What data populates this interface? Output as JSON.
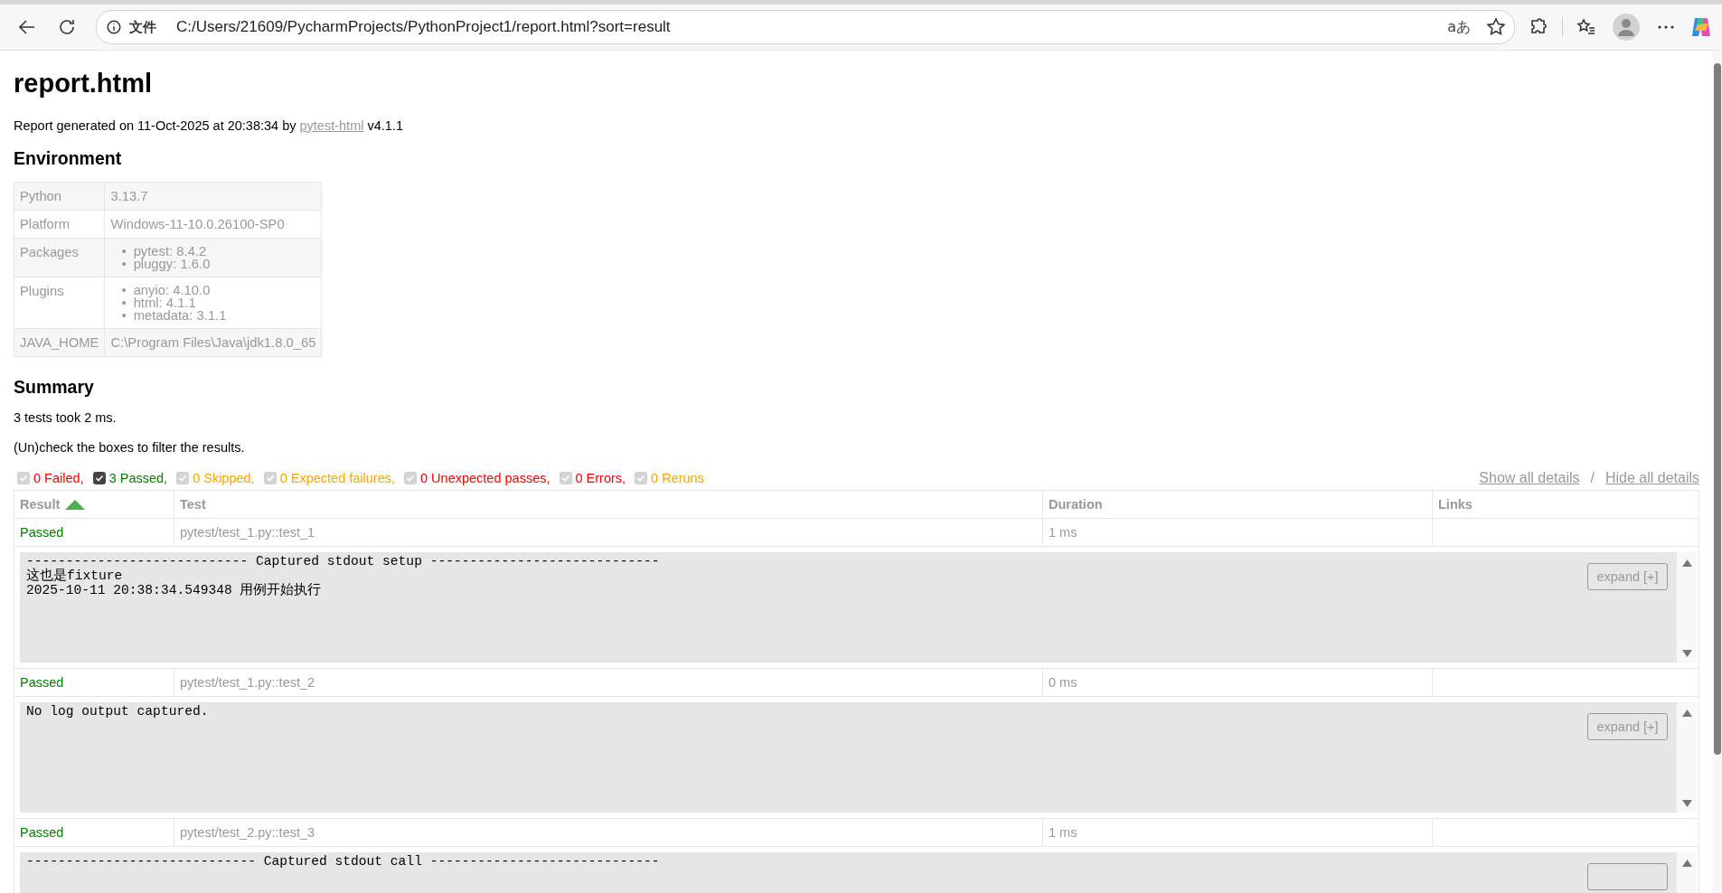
{
  "browser": {
    "site_label": "文件",
    "url": "C:/Users/21609/PycharmProjects/PythonProject1/report.html?sort=result",
    "translate_glyph": "aあ"
  },
  "report": {
    "title": "report.html",
    "generated": {
      "before": "Report generated on 11-Oct-2025 at 20:38:34 by ",
      "link": "pytest-html",
      "after": " v4.1.1"
    },
    "environment": {
      "heading": "Environment",
      "bullet": "•",
      "rows": [
        {
          "key": "Python",
          "kind": "text",
          "value": "3.13.7"
        },
        {
          "key": "Platform",
          "kind": "text",
          "value": "Windows-11-10.0.26100-SP0"
        },
        {
          "key": "Packages",
          "kind": "list",
          "items": [
            "pytest: 8.4.2",
            "pluggy: 1.6.0"
          ]
        },
        {
          "key": "Plugins",
          "kind": "list",
          "items": [
            "anyio: 4.10.0",
            "html: 4.1.1",
            "metadata: 3.1.1"
          ]
        },
        {
          "key": "JAVA_HOME",
          "kind": "text",
          "value": "C:\\Program Files\\Java\\jdk1.8.0_65"
        }
      ]
    },
    "summary": {
      "heading": "Summary",
      "duration": "3 tests took 2 ms.",
      "hint": "(Un)check the boxes to filter the results.",
      "filters": [
        {
          "label": "0 Failed,",
          "checked": true,
          "disabled": true,
          "color": "#ff0000"
        },
        {
          "label": "3 Passed,",
          "checked": true,
          "disabled": false,
          "color": "#008000"
        },
        {
          "label": "0 Skipped,",
          "checked": true,
          "disabled": true,
          "color": "#ffa500"
        },
        {
          "label": "0 Expected failures,",
          "checked": true,
          "disabled": true,
          "color": "#ffa500"
        },
        {
          "label": "0 Unexpected passes,",
          "checked": true,
          "disabled": true,
          "color": "#ff0000"
        },
        {
          "label": "0 Errors,",
          "checked": true,
          "disabled": true,
          "color": "#ff0000"
        },
        {
          "label": "0 Reruns",
          "checked": true,
          "disabled": true,
          "color": "#ffa500"
        }
      ],
      "show_all": "Show all details",
      "separator": "/",
      "hide_all": "Hide all details"
    },
    "table": {
      "columns": [
        {
          "label": "Result",
          "sorted": true
        },
        {
          "label": "Test",
          "sorted": false
        },
        {
          "label": "Duration",
          "sorted": false
        },
        {
          "label": "Links",
          "sorted": false
        }
      ],
      "rows": [
        {
          "result": "Passed",
          "test": "pytest/test_1.py::test_1",
          "duration": "1 ms",
          "log": {
            "lines": [
              "---------------------------- Captured stdout setup -----------------------------",
              "这也是fixture",
              "2025-10-11 20:38:34.549348 用例开始执行"
            ],
            "button": "expand [+]"
          }
        },
        {
          "result": "Passed",
          "test": "pytest/test_1.py::test_2",
          "duration": "0 ms",
          "log": {
            "lines": [
              "No log output captured."
            ],
            "button": "expand [+]"
          }
        },
        {
          "result": "Passed",
          "test": "pytest/test_2.py::test_3",
          "duration": "1 ms",
          "log": {
            "lines": [
              "----------------------------- Captured stdout call -----------------------------"
            ]
          }
        }
      ]
    }
  }
}
